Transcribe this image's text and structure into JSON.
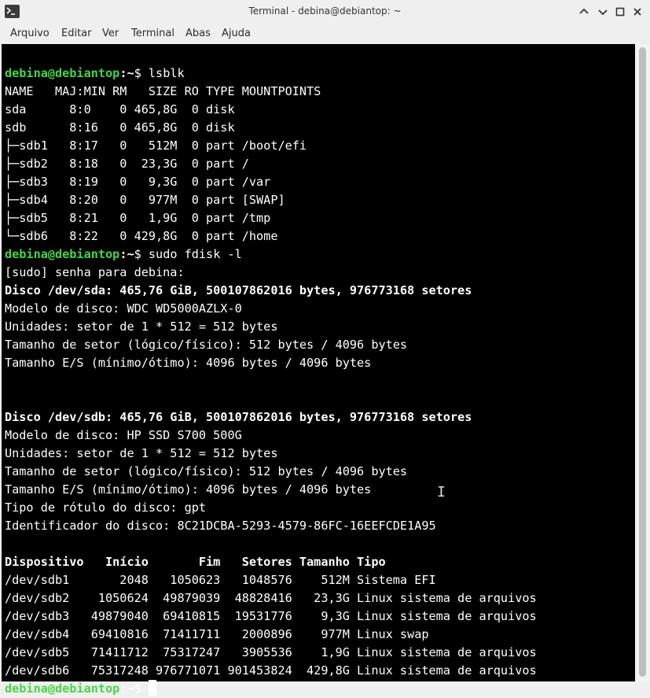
{
  "window": {
    "title": "Terminal - debina@debiantop: ~"
  },
  "menu": [
    "Arquivo",
    "Editar",
    "Ver",
    "Terminal",
    "Abas",
    "Ajuda"
  ],
  "terminal": {
    "user_host": "debina@debiantop",
    "lines": [
      {
        "type": "prompt",
        "path": ":~",
        "symbol": "$",
        "cmd": " lsblk"
      },
      {
        "type": "text",
        "text": "NAME   MAJ:MIN RM   SIZE RO TYPE MOUNTPOINTS"
      },
      {
        "type": "text",
        "text": "sda      8:0    0 465,8G  0 disk"
      },
      {
        "type": "text",
        "text": "sdb      8:16   0 465,8G  0 disk"
      },
      {
        "type": "text",
        "text": "├─sdb1   8:17   0   512M  0 part /boot/efi"
      },
      {
        "type": "text",
        "text": "├─sdb2   8:18   0  23,3G  0 part /"
      },
      {
        "type": "text",
        "text": "├─sdb3   8:19   0   9,3G  0 part /var"
      },
      {
        "type": "text",
        "text": "├─sdb4   8:20   0   977M  0 part [SWAP]"
      },
      {
        "type": "text",
        "text": "├─sdb5   8:21   0   1,9G  0 part /tmp"
      },
      {
        "type": "text",
        "text": "└─sdb6   8:22   0 429,8G  0 part /home"
      },
      {
        "type": "prompt",
        "path": ":~",
        "symbol": "$",
        "cmd": " sudo fdisk -l"
      },
      {
        "type": "text",
        "text": "[sudo] senha para debina:"
      },
      {
        "type": "bold",
        "text": "Disco /dev/sda: 465,76 GiB, 500107862016 bytes, 976773168 setores"
      },
      {
        "type": "text",
        "text": "Modelo de disco: WDC WD5000AZLX-0"
      },
      {
        "type": "text",
        "text": "Unidades: setor de 1 * 512 = 512 bytes"
      },
      {
        "type": "text",
        "text": "Tamanho de setor (lógico/físico): 512 bytes / 4096 bytes"
      },
      {
        "type": "text",
        "text": "Tamanho E/S (mínimo/ótimo): 4096 bytes / 4096 bytes"
      },
      {
        "type": "text",
        "text": ""
      },
      {
        "type": "text",
        "text": ""
      },
      {
        "type": "bold",
        "text": "Disco /dev/sdb: 465,76 GiB, 500107862016 bytes, 976773168 setores"
      },
      {
        "type": "text",
        "text": "Modelo de disco: HP SSD S700 500G"
      },
      {
        "type": "text",
        "text": "Unidades: setor de 1 * 512 = 512 bytes"
      },
      {
        "type": "text",
        "text": "Tamanho de setor (lógico/físico): 512 bytes / 4096 bytes"
      },
      {
        "type": "text",
        "text": "Tamanho E/S (mínimo/ótimo): 4096 bytes / 4096 bytes"
      },
      {
        "type": "text",
        "text": "Tipo de rótulo do disco: gpt"
      },
      {
        "type": "text",
        "text": "Identificador do disco: 8C21DCBA-5293-4579-86FC-16EEFCDE1A95"
      },
      {
        "type": "text",
        "text": ""
      },
      {
        "type": "bold",
        "text": "Dispositivo   Início       Fim   Setores Tamanho Tipo"
      },
      {
        "type": "text",
        "text": "/dev/sdb1       2048   1050623   1048576    512M Sistema EFI"
      },
      {
        "type": "text",
        "text": "/dev/sdb2    1050624  49879039  48828416   23,3G Linux sistema de arquivos"
      },
      {
        "type": "text",
        "text": "/dev/sdb3   49879040  69410815  19531776    9,3G Linux sistema de arquivos"
      },
      {
        "type": "text",
        "text": "/dev/sdb4   69410816  71411711   2000896    977M Linux swap"
      },
      {
        "type": "text",
        "text": "/dev/sdb5   71411712  75317247   3905536    1,9G Linux sistema de arquivos"
      },
      {
        "type": "text",
        "text": "/dev/sdb6   75317248 976771071 901453824  429,8G Linux sistema de arquivos"
      },
      {
        "type": "prompt",
        "path": ":~",
        "symbol": "$",
        "cmd": " ",
        "cursor": true
      }
    ]
  },
  "colors": {
    "prompt": "#43d843",
    "background": "#000000",
    "foreground": "#ffffff"
  }
}
